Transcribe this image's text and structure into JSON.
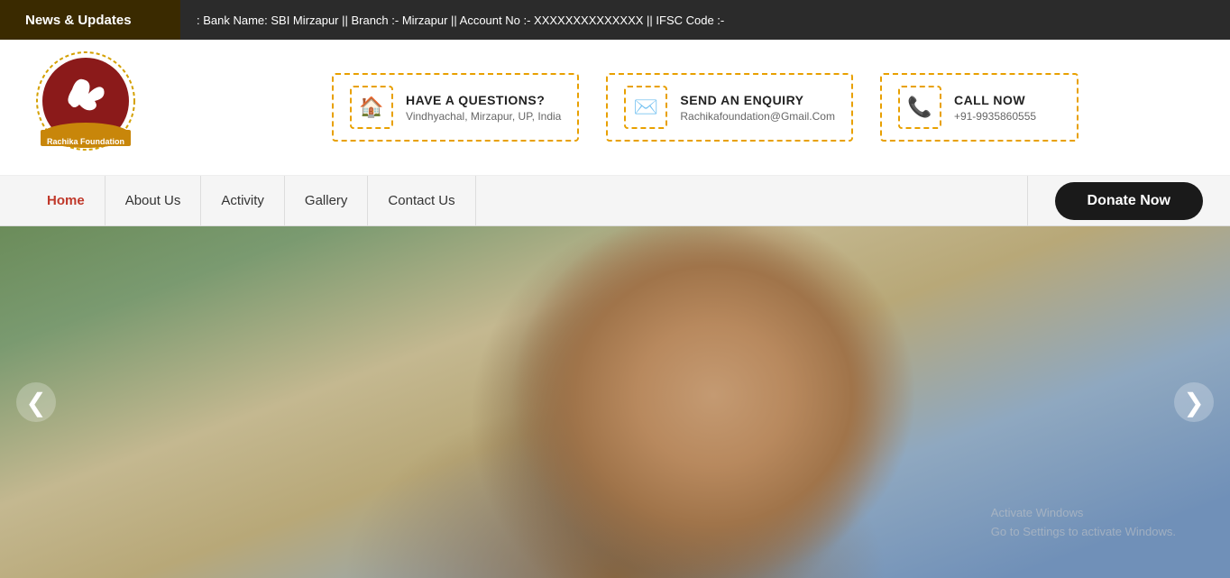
{
  "topbar": {
    "news_tab_label": "News & Updates",
    "ticker_text": ": Bank Name: SBI Mirzapur || Branch :- Mirzapur || Account No :- XXXXXXXXXXXXXX || IFSC Code :-"
  },
  "header": {
    "logo_alt": "Rachika Foundation",
    "logo_name": "Rachika Foundation",
    "contacts": [
      {
        "icon": "home",
        "title": "HAVE A QUESTIONS?",
        "sub": "Vindhyachal, Mirzapur, UP, India"
      },
      {
        "icon": "envelope",
        "title": "SEND AN ENQUIRY",
        "sub": "Rachikafoundation@Gmail.Com"
      },
      {
        "icon": "phone",
        "title": "CALL NOW",
        "sub": "+91-9935860555"
      }
    ]
  },
  "navbar": {
    "items": [
      {
        "label": "Home",
        "active": true
      },
      {
        "label": "About Us",
        "active": false
      },
      {
        "label": "Activity",
        "active": false
      },
      {
        "label": "Gallery",
        "active": false
      },
      {
        "label": "Contact Us",
        "active": false
      }
    ],
    "donate_label": "Donate Now"
  },
  "hero": {
    "prev_label": "❮",
    "next_label": "❯",
    "watermark_line1": "Activate Windows",
    "watermark_line2": "Go to Settings to activate Windows."
  }
}
